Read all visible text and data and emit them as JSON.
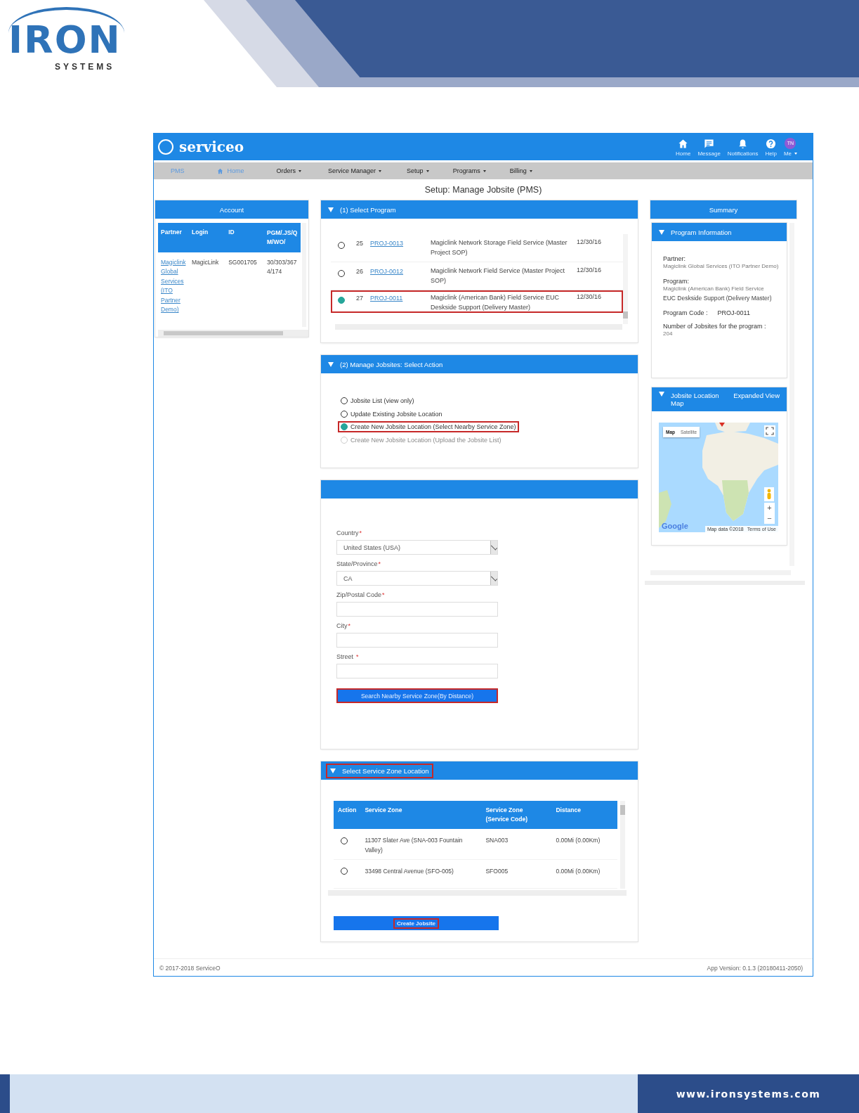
{
  "document_header": {
    "logo_word": "IRON",
    "logo_tagline": "SYSTEMS"
  },
  "app": {
    "brand": "serviceo",
    "top_icons": [
      {
        "kind": "home",
        "label": "Home"
      },
      {
        "kind": "message",
        "label": "Message"
      },
      {
        "kind": "bell",
        "label": "Notifications"
      },
      {
        "kind": "help",
        "label": "Help"
      },
      {
        "kind": "avatar",
        "initials": "TN",
        "label": "Me"
      }
    ],
    "nav": [
      {
        "kind": "link",
        "label": "PMS"
      },
      {
        "kind": "home",
        "label": "Home"
      },
      {
        "kind": "menu",
        "label": "Orders"
      },
      {
        "kind": "menu",
        "label": "Service Manager"
      },
      {
        "kind": "menu",
        "label": "Setup"
      },
      {
        "kind": "menu",
        "label": "Programs"
      },
      {
        "kind": "menu",
        "label": "Billing"
      }
    ],
    "page_title": "Setup: Manage Jobsite (PMS)",
    "account": {
      "title": "Account",
      "columns": [
        "Partner",
        "Login",
        "ID",
        "PGM/.JS/QM/WO/"
      ],
      "rows": [
        {
          "partner": "Magiclink Global Services (ITO Partner Demo)",
          "login": "MagicLink",
          "id": "SG001705",
          "column_4": "30/303/3674/174"
        }
      ]
    },
    "select_program": {
      "title": "(1) Select Program",
      "expanded": true,
      "rows": [
        {
          "selected": false,
          "highlighted": false,
          "column_2": "25",
          "column_3": "PROJ-0013",
          "column_4": "Magiclink Network Storage Field Service (Master Project SOP)",
          "column_5": "12/30/16"
        },
        {
          "selected": false,
          "highlighted": false,
          "column_2": "26",
          "column_3": "PROJ-0012",
          "column_4": "Magiclink Network Field Service (Master Project SOP)",
          "column_5": "12/30/16"
        },
        {
          "selected": true,
          "highlighted": true,
          "column_2": "27",
          "column_3": "PROJ-0011",
          "column_4": "Magiclink (American Bank) Field Service EUC Deskside Support (Delivery Master)",
          "column_5": "12/30/16"
        }
      ]
    },
    "manage_jobsites": {
      "title": "(2) Manage Jobsites: Select Action",
      "expanded": true,
      "actions": [
        {
          "label": "Jobsite List (view only)",
          "selected": false,
          "disabled": false,
          "highlighted": false
        },
        {
          "label": "Update Existing Jobsite Location",
          "selected": false,
          "disabled": false,
          "highlighted": false
        },
        {
          "label": "Create New Jobsite Location (Select Nearby Service Zone)",
          "selected": true,
          "disabled": false,
          "highlighted": true
        },
        {
          "label": "Create New Jobsite Location (Upload the Jobsite List)",
          "selected": false,
          "disabled": true,
          "highlighted": false
        }
      ]
    },
    "location_form": {
      "fields": [
        {
          "kind": "select",
          "label": "Country",
          "required_mark": "*",
          "value": "United States (USA)"
        },
        {
          "kind": "select",
          "label": "State/Province",
          "required_mark": "*",
          "value": "CA"
        },
        {
          "kind": "text",
          "label": "Zip/Postal Code",
          "required_mark": "*"
        },
        {
          "kind": "text",
          "label": "City",
          "required_mark": "*"
        },
        {
          "kind": "text",
          "label": "Street",
          "required_mark": "*"
        }
      ],
      "button": {
        "label": "Search Nearby Service Zone(By Distance)",
        "highlighted": true
      }
    },
    "service_zone": {
      "title": "Select Service Zone Location",
      "expanded": true,
      "title_highlighted": true,
      "columns": [
        "Action",
        "Service Zone",
        "Service Zone (Service Code)",
        "Distance"
      ],
      "rows": [
        {
          "selected": false,
          "zone": "11307 Slater Ave (SNA-003 Fountain Valley)",
          "code": "SNA003",
          "distance": "0.00Mi (0.00Km)"
        },
        {
          "selected": false,
          "zone": "33498 Central Avenue (SFO-005)",
          "code": "SFO005",
          "distance": "0.00Mi (0.00Km)"
        }
      ],
      "button": {
        "label": "Create Jobsite",
        "highlighted": true
      }
    },
    "summary": {
      "title": "Summary",
      "program_information": {
        "title": "Program Information",
        "expanded": true,
        "partner_label": "Partner:",
        "partner": "Magiclink Global Services (ITO Partner Demo)",
        "program_label": "Program:",
        "program_line_1": "Magiclink (American Bank) Field Service",
        "program_line_2": "EUC Deskside Support (Delivery Master)",
        "code_label": "Program Code :",
        "code": "PROJ-0011",
        "count_label": "Number of Jobsites for the program :",
        "count": "204"
      },
      "map_panel": {
        "title": "Jobsite Location Map",
        "expanded": true,
        "link": "Expanded View",
        "map_types": [
          {
            "label": "Map",
            "selected": true
          },
          {
            "label": "Satellite",
            "selected": false
          }
        ],
        "zoom_in": "+",
        "zoom_out": "−",
        "attribution": "Google",
        "map_data": "Map data ©2018",
        "terms": "Terms of Use"
      }
    },
    "footer": {
      "copyright": "© 2017-2018 ServiceO",
      "version": "App Version: 0.1.3 (20180411-2050)"
    }
  },
  "document_footer": {
    "website": "www.ironsystems.com"
  }
}
